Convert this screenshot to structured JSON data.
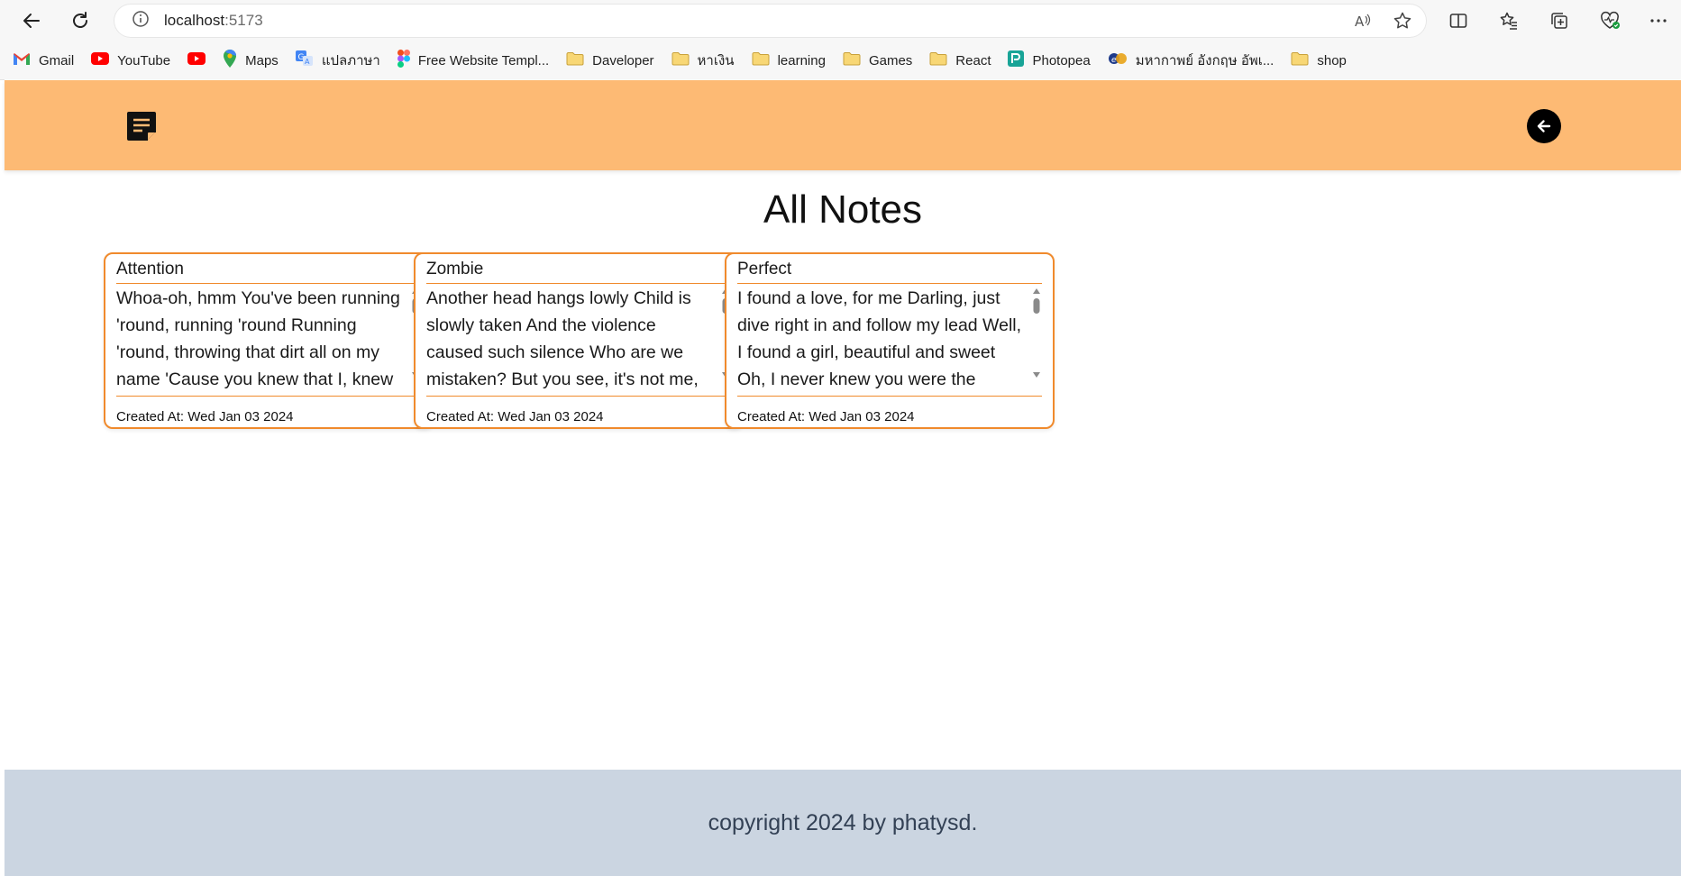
{
  "browser": {
    "address": {
      "host": "localhost",
      "port": ":5173"
    },
    "bookmarks": [
      {
        "label": "Gmail",
        "icon": "gmail-icon",
        "color": "#EA4335"
      },
      {
        "label": "YouTube",
        "icon": "youtube-icon",
        "color": "#FF0000"
      },
      {
        "label": "",
        "icon": "youtube-icon",
        "color": "#FF0000"
      },
      {
        "label": "Maps",
        "icon": "maps-icon",
        "color": "#34A853"
      },
      {
        "label": "แปลภาษา",
        "icon": "translate-icon",
        "color": "#4285F4"
      },
      {
        "label": "Free Website Templ...",
        "icon": "figma-icon",
        "color": "#A259FF"
      },
      {
        "label": "Daveloper",
        "icon": "folder-icon",
        "color": "#F2C94C"
      },
      {
        "label": "หาเงิน",
        "icon": "folder-icon",
        "color": "#F2C94C"
      },
      {
        "label": "learning",
        "icon": "folder-icon",
        "color": "#F2C94C"
      },
      {
        "label": "Games",
        "icon": "folder-icon",
        "color": "#F2C94C"
      },
      {
        "label": "React",
        "icon": "folder-icon",
        "color": "#F2C94C"
      },
      {
        "label": "Photopea",
        "icon": "photopea-icon",
        "color": "#18A497"
      },
      {
        "label": "มหากาพย์ อังกฤษ อัพเ...",
        "icon": "site-icon",
        "color": "#1E3A8A"
      },
      {
        "label": "shop",
        "icon": "folder-icon",
        "color": "#F2C94C"
      }
    ]
  },
  "app": {
    "colors": {
      "header": "#fdba74",
      "card_border": "#f08a2c",
      "footer": "#cbd5e1"
    },
    "page_title": "All Notes",
    "notes": [
      {
        "title": "Attention",
        "body": "Whoa-oh, hmm You've been running 'round, running 'round Running 'round, throwing that dirt all on my name 'Cause you knew that I, knew that I'd call you up",
        "created": "Created At: Wed Jan 03 2024"
      },
      {
        "title": "Zombie",
        "body": "Another head hangs lowly Child is slowly taken And the violence caused such silence Who are we mistaken? But you see, it's not me, it's not my family",
        "created": "Created At: Wed Jan 03 2024"
      },
      {
        "title": "Perfect",
        "body": "I found a love, for me Darling, just dive right in and follow my lead Well, I found a girl, beautiful and sweet Oh, I never knew you were the someone waiting for me",
        "created": "Created At: Wed Jan 03 2024"
      }
    ],
    "footer": "copyright 2024 by phatysd."
  }
}
